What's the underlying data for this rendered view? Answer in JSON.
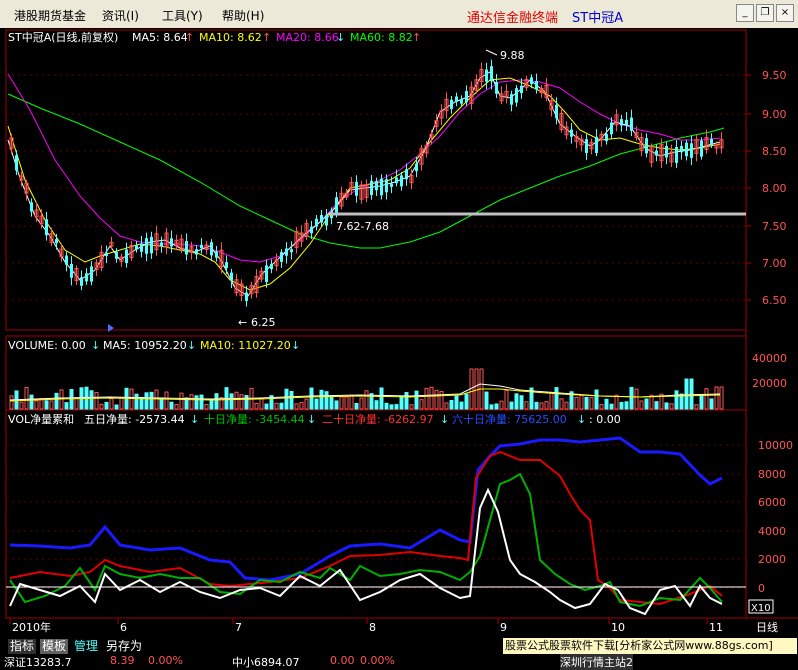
{
  "menubar": {
    "items": [
      "港股期货基金",
      "资讯(I)",
      "工具(Y)",
      "帮助(H)"
    ],
    "app_title": "通达信金融终端",
    "stock_title": "ST中冠A"
  },
  "price_panel": {
    "title": "ST中冠A(日线,前复权)",
    "ma5": "MA5: 8.64",
    "ma10": "MA10: 8.62",
    "ma20": "MA20: 8.66",
    "ma60": "MA60: 8.82",
    "high_label": "9.88",
    "low_label": "6.25",
    "range_label": "7.62-7.68",
    "y_ticks": [
      "9.50",
      "9.00",
      "8.50",
      "8.00",
      "7.50",
      "7.00",
      "6.50"
    ],
    "colors": {
      "ma5": "#ffffff",
      "ma10": "#ffff00",
      "ma20": "#ff00ff",
      "ma60": "#00ff00",
      "up": "#ff5555",
      "down": "#54ffff"
    }
  },
  "volume_panel": {
    "title": "VOLUME: 0.00",
    "ma5": "MA5: 10952.20",
    "ma10": "MA10: 11027.20",
    "y_ticks": [
      "40000",
      "20000"
    ]
  },
  "vol_net_panel": {
    "title": "VOL净量累和",
    "five_day": "五日净量: -2573.44",
    "ten_day": "十日净量: -3454.44",
    "twenty_day": "二十日净量: -6262.97",
    "sixty_day": "六十日净量: 75625.00",
    "extra": ": 0.00",
    "y_ticks": [
      "10000",
      "8000",
      "6000",
      "4000",
      "2000",
      "0"
    ],
    "scale_label": "X10"
  },
  "x_axis": {
    "labels": [
      "2010年",
      "6",
      "7",
      "8",
      "9",
      "10",
      "11"
    ],
    "period": "日线"
  },
  "bottom": {
    "tabs": [
      "指标",
      "模板",
      "管理",
      "另存为"
    ],
    "promo": "股票公式股票软件下载[分析家公式网www.88gs.com]",
    "ticker_items": [
      "深证13283.7",
      "8.39",
      "0.00%",
      "中小6894.07",
      "0.00",
      "0.00%",
      "深圳行情主站2"
    ]
  },
  "chart_data": {
    "type": "candlestick",
    "x": [
      "2010年",
      "6",
      "7",
      "8",
      "9",
      "10",
      "11"
    ],
    "price_ylim": [
      6.25,
      9.88
    ],
    "notable": {
      "high": 9.88,
      "low": 6.25,
      "range": "7.62-7.68"
    },
    "indicator_ylim": [
      0,
      10000
    ]
  }
}
